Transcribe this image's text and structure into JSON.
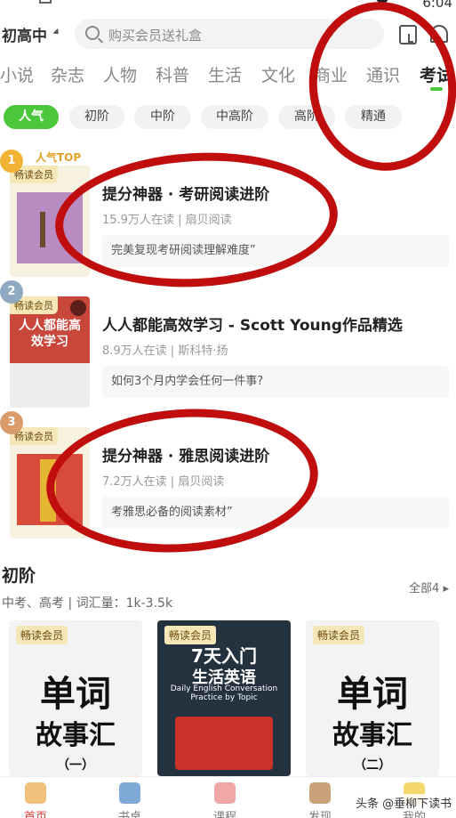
{
  "status_bar": {
    "time": "6:04"
  },
  "header": {
    "grade": "初高中",
    "search_placeholder": "购买会员送礼盒"
  },
  "categories": [
    "小说",
    "杂志",
    "人物",
    "科普",
    "生活",
    "文化",
    "商业",
    "通识",
    "考试"
  ],
  "active_category": "考试",
  "levels": [
    "人气",
    "初阶",
    "中阶",
    "中高阶",
    "高阶",
    "精通"
  ],
  "active_level": "人气",
  "rank_label": "人气TOP",
  "ranking": [
    {
      "rank": "1",
      "tag": "畅读会员",
      "title": "提分神器 · 考研阅读进阶",
      "meta": "15.9万人在读 | 扇贝阅读",
      "quote": "完美复现考研阅读理解难度”"
    },
    {
      "rank": "2",
      "tag": "畅读会员",
      "title": "人人都能高效学习 - Scott Young作品精选",
      "meta": "8.9万人在读 | 斯科特·扬",
      "quote": "如何3个月内学会任何一件事?",
      "cover_text": "人人都能高效学习"
    },
    {
      "rank": "3",
      "tag": "畅读会员",
      "title": "提分神器 · 雅思阅读进阶",
      "meta": "7.2万人在读 | 扇贝阅读",
      "quote": "考雅思必备的阅读素材”"
    }
  ],
  "section": {
    "title": "初阶",
    "subtitle": "中考、高考 | 词汇量：1k-3.5k",
    "more": "全部4"
  },
  "books": [
    {
      "tag": "畅读会员",
      "line1": "单词",
      "line2": "故事汇",
      "line3": "（一）"
    },
    {
      "tag": "畅读会员",
      "line1": "7天入门",
      "line2": "生活英语",
      "line3": "Daily English Conversation Practice by Topic"
    },
    {
      "tag": "畅读会员",
      "line1": "单词",
      "line2": "故事汇",
      "line3": "（二）"
    }
  ],
  "nav": [
    "首页",
    "书桌",
    "课程",
    "发现",
    "我的"
  ],
  "watermark": "头条 @垂柳下读书",
  "colors": {
    "accent_green": "#4cc63a",
    "annotation_red": "#c00d0d",
    "member_gold": "#f6e7b8"
  }
}
